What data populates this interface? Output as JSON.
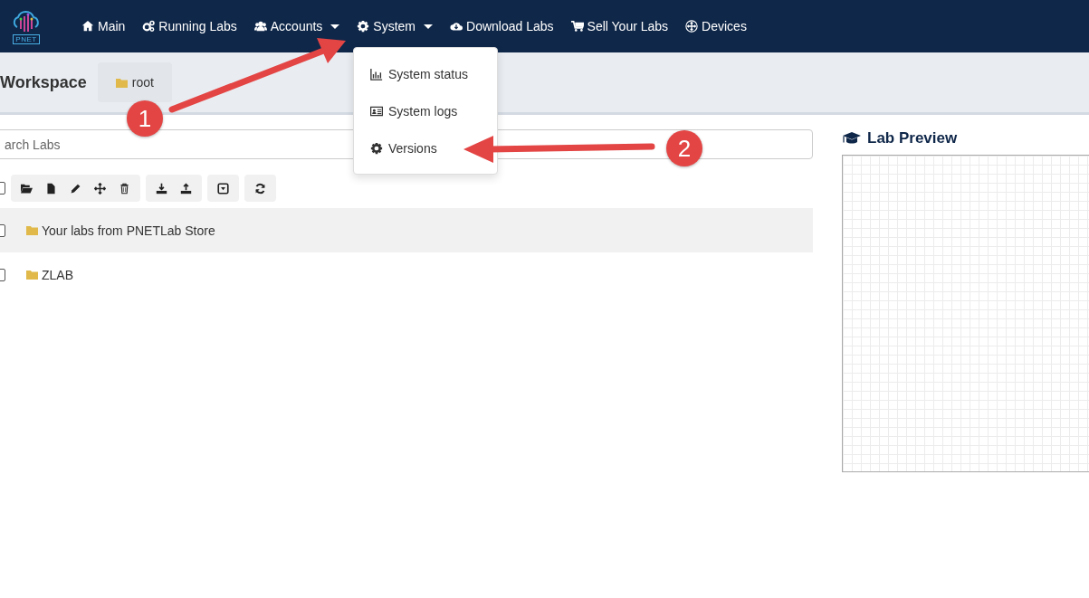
{
  "navbar": {
    "logo_text": "PNET",
    "items": [
      {
        "label": "Main",
        "kind": "home",
        "dropdown": false
      },
      {
        "label": "Running Labs",
        "kind": "gears",
        "dropdown": false
      },
      {
        "label": "Accounts",
        "kind": "users",
        "dropdown": true
      },
      {
        "label": "System",
        "kind": "gear",
        "dropdown": true
      },
      {
        "label": "Download Labs",
        "kind": "cloud",
        "dropdown": false
      },
      {
        "label": "Sell Your Labs",
        "kind": "cart",
        "dropdown": false
      },
      {
        "label": "Devices",
        "kind": "plus",
        "dropdown": false
      }
    ]
  },
  "system_menu": {
    "items": [
      {
        "label": "System status",
        "kind": "chart"
      },
      {
        "label": "System logs",
        "kind": "card"
      },
      {
        "label": "Versions",
        "kind": "gear"
      }
    ]
  },
  "workspace": {
    "title": "Workspace",
    "folder": "root"
  },
  "search": {
    "placeholder": "arch Labs"
  },
  "select_all": {
    "checked": false
  },
  "rows": [
    {
      "name": "Your labs from PNETLab Store",
      "checked": false,
      "selected": true
    },
    {
      "name": "ZLAB",
      "checked": false,
      "selected": false
    }
  ],
  "preview": {
    "title": "Lab Preview"
  },
  "annotations": [
    {
      "number": "1"
    },
    {
      "number": "2"
    }
  ]
}
